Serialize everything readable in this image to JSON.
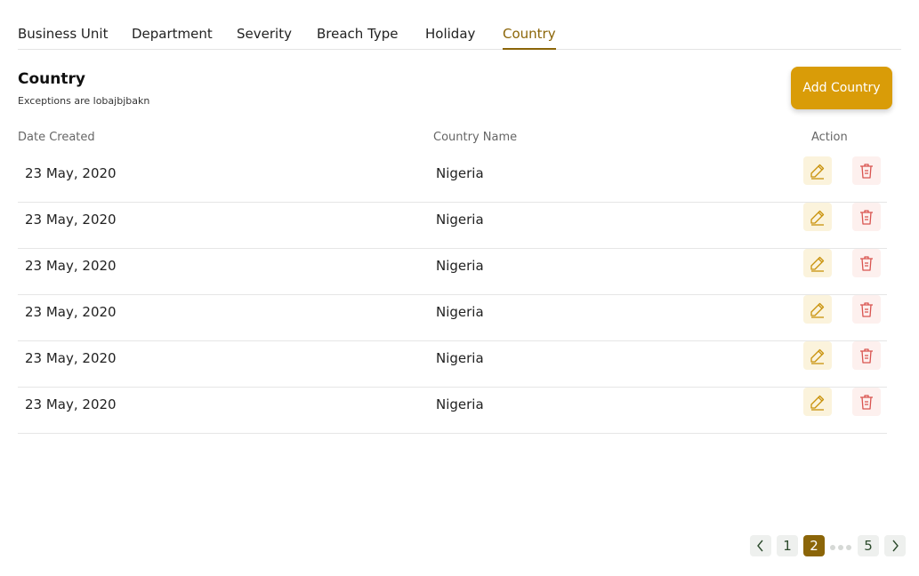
{
  "tabs": [
    {
      "label": "Business Unit",
      "active": false
    },
    {
      "label": "Department",
      "active": false
    },
    {
      "label": "Severity",
      "active": false
    },
    {
      "label": "Breach Type",
      "active": false
    },
    {
      "label": "Holiday",
      "active": false
    },
    {
      "label": "Country",
      "active": true
    }
  ],
  "header": {
    "title": "Country",
    "subtitle": "Exceptions are lobajbjbakn",
    "add_button_label": "Add Country"
  },
  "table": {
    "columns": [
      "Date Created",
      "Country Name",
      "Action"
    ],
    "rows": [
      {
        "date": "23 May, 2020",
        "country": "Nigeria"
      },
      {
        "date": "23 May, 2020",
        "country": "Nigeria"
      },
      {
        "date": "23 May, 2020",
        "country": "Nigeria"
      },
      {
        "date": "23 May, 2020",
        "country": "Nigeria"
      },
      {
        "date": "23 May, 2020",
        "country": "Nigeria"
      },
      {
        "date": "23 May, 2020",
        "country": "Nigeria"
      }
    ],
    "row_actions": [
      "edit-icon",
      "trash-icon"
    ]
  },
  "pagination": {
    "pages": [
      "1",
      "2",
      "5"
    ],
    "current": "2",
    "icons": [
      "chevron-left-icon",
      "ellipsis-icon",
      "chevron-right-icon"
    ]
  },
  "colors": {
    "accent": "#d99c08",
    "active_tab": "#8b6508",
    "edit_icon": "#c9920c",
    "delete_icon": "#d9534f"
  }
}
